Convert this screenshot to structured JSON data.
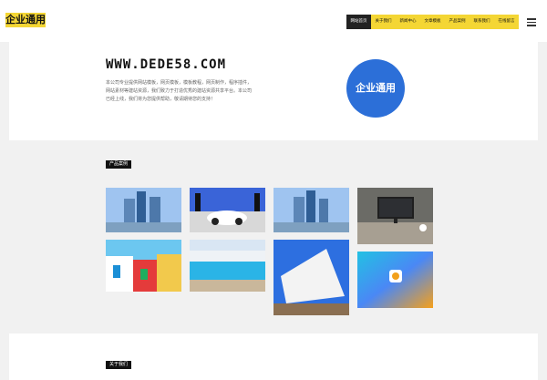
{
  "header": {
    "logo": "企业通用",
    "nav": [
      "网站首页",
      "关于我们",
      "新闻中心",
      "文章模板",
      "产品案例",
      "联系我们",
      "在线留言"
    ],
    "menu_icon": "hamburger-icon"
  },
  "hero": {
    "title": "WWW.DEDE58.COM",
    "description": "本公司专业提供网站模板，网页模板，模板教程，网页制作，程序插件，网站素材等建站资源，我们致力于打造优秀的建站资源共享平台。本公司已经上线，我们将为您提供帮助，敬请期待您的支持！",
    "circle_label": "企业通用"
  },
  "products": {
    "label": "产品案例",
    "items": [
      {
        "name": "tall-buildings-1"
      },
      {
        "name": "white-sports-car"
      },
      {
        "name": "tall-buildings-2"
      },
      {
        "name": "desk-monitor"
      },
      {
        "name": "colorful-houses"
      },
      {
        "name": "resort-pool"
      },
      {
        "name": "white-modern-building"
      },
      {
        "name": "app-icon-gradient"
      }
    ]
  },
  "about": {
    "label": "关于我们"
  },
  "colors": {
    "accent": "#f4d634",
    "circle": "#2c6fd8"
  }
}
